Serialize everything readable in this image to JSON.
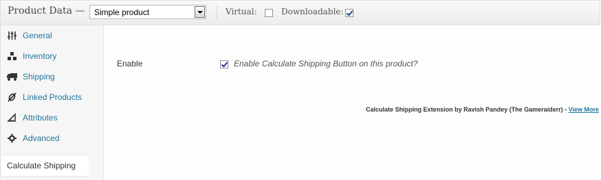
{
  "header": {
    "title": "Product Data —",
    "product_type": "Simple product",
    "virtual_label": "Virtual:",
    "virtual_checked": false,
    "downloadable_label": "Downloadable:",
    "downloadable_checked": true
  },
  "sidebar": {
    "items": [
      {
        "label": "General",
        "icon": "sliders-icon"
      },
      {
        "label": "Inventory",
        "icon": "boxes-icon"
      },
      {
        "label": "Shipping",
        "icon": "truck-icon"
      },
      {
        "label": "Linked Products",
        "icon": "link-icon"
      },
      {
        "label": "Attributes",
        "icon": "ruler-icon"
      },
      {
        "label": "Advanced",
        "icon": "gear-icon"
      },
      {
        "label": "Calculate Shipping",
        "icon": "",
        "active": true
      }
    ]
  },
  "main": {
    "enable_label": "Enable",
    "enable_checked": true,
    "enable_description": "Enable Calculate Shipping Button on this product?",
    "credit_text": "Calculate Shipping Extension by Ravish Pandey (The Gameraiderr) -",
    "credit_link": "View More"
  }
}
